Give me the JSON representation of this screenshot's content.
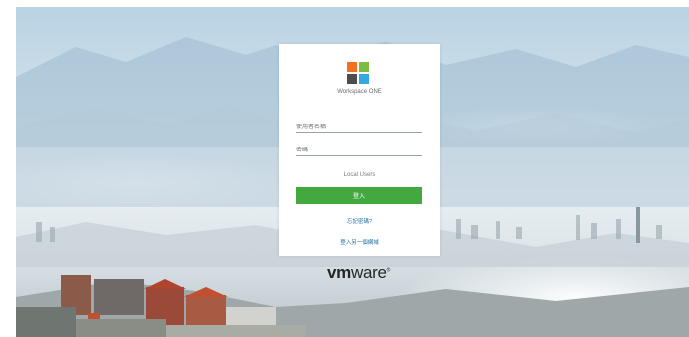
{
  "login": {
    "product_name": "Workspace ONE",
    "username_placeholder": "使用者名稱",
    "password_placeholder": "密碼",
    "domain": "Local Users",
    "signin_label": "登入",
    "forgot_password_link": "忘記密碼?",
    "alt_login_link": "登入另一個網域"
  },
  "footer": {
    "vendor_logo_text_bold": "vm",
    "vendor_logo_text_regular": "ware",
    "trademark": "®"
  },
  "logo_colors": [
    "#f37021",
    "#7fba42",
    "#4d4d4f",
    "#35a8e0"
  ],
  "accent_color": "#43a83f",
  "link_color": "#1e6fa8",
  "background_image": "mountain city landscape with fog"
}
